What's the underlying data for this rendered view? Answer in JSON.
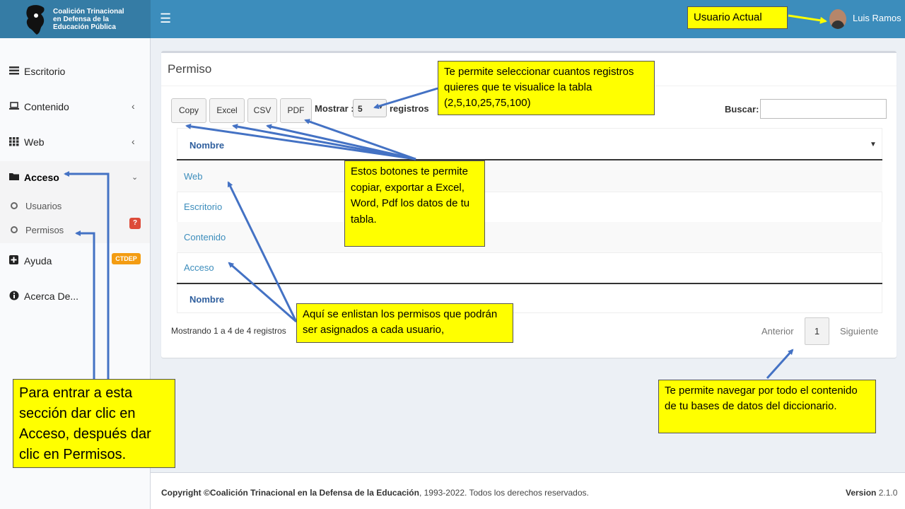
{
  "header": {
    "logo_line1": "Coalición Trinacional",
    "logo_line2": "en Defensa de la",
    "logo_line3": "Educación Pública",
    "menu_icon": "hamburger-icon",
    "user_name": "Luis Ramos"
  },
  "sidebar": {
    "items": [
      {
        "label": "Escritorio",
        "icon": "list-icon"
      },
      {
        "label": "Contenido",
        "icon": "laptop-icon"
      },
      {
        "label": "Web",
        "icon": "grid-icon"
      },
      {
        "label": "Acceso",
        "icon": "folder-icon"
      },
      {
        "label": "Ayuda",
        "icon": "plus-square-icon"
      },
      {
        "label": "Acerca De...",
        "icon": "info-icon"
      }
    ],
    "subitems": [
      {
        "label": "Usuarios"
      },
      {
        "label": "Permisos"
      }
    ],
    "ayuda_badge": "?",
    "acerca_badge": "CTDEP",
    "colors": {
      "badge_red": "#dd4b39",
      "badge_orange": "#f39c12"
    }
  },
  "main": {
    "title": "Permiso",
    "buttons": {
      "copy": "Copy",
      "excel": "Excel",
      "csv": "CSV",
      "pdf": "PDF"
    },
    "show_label": "Mostrar :",
    "show_value": "5",
    "show_suffix": "registros",
    "search_label": "Buscar:",
    "search_value": "",
    "table": {
      "column": "Nombre",
      "rows": [
        "Web",
        "Escritorio",
        "Contenido",
        "Acceso"
      ],
      "footer_column": "Nombre"
    },
    "info": "Mostrando 1 a 4 de 4 registros",
    "pagination": {
      "prev": "Anterior",
      "page": "1",
      "next": "Siguiente"
    }
  },
  "footer": {
    "copyright_prefix": "Copyright ©",
    "org": "Coalición Trinacional en la Defensa de la Educación",
    "copyright_suffix": ", 1993-2022. Todos los derechos reservados.",
    "version_label": "Version",
    "version_value": "2.1.0"
  },
  "callouts": {
    "user": "Usuario Actual",
    "select": "Te permite seleccionar cuantos registros quieres que te visualice la tabla (2,5,10,25,75,100)",
    "buttons": "Estos botones te permite copiar, exportar a Excel, Word, Pdf los datos de tu tabla.",
    "list": "Aquí se enlistan los permisos que podrán ser asignados a cada usuario,",
    "access": "Para entrar a esta sección dar clic en Acceso, después dar clic en Permisos.",
    "navigation": "Te permite navegar por todo el contenido de tu bases de datos del diccionario."
  },
  "colors": {
    "header": "#3c8dbc",
    "logo_bg": "#357ca5",
    "callout": "#ffff00",
    "arrow_blue": "#4472c4",
    "arrow_yellow": "#ffff00"
  }
}
